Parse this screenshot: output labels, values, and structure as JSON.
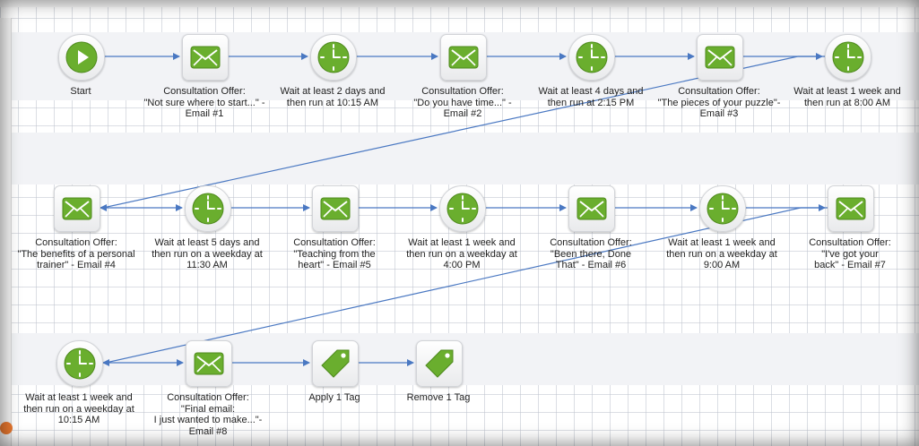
{
  "colors": {
    "edge": "#4a78c2",
    "icon_green": "#6aae2e",
    "band": "#f2f3f6",
    "accent_dot": "#e8772e"
  },
  "nodes": [
    {
      "icon": "play-icon",
      "label": "Start"
    },
    {
      "icon": "email-icon",
      "label": "Consultation Offer:\n\"Not sure where to start...\" -\nEmail #1"
    },
    {
      "icon": "clock-icon",
      "label": "Wait at least 2 days and\nthen run at 10:15 AM"
    },
    {
      "icon": "email-icon",
      "label": "Consultation Offer:\n\"Do you have time...\" -\nEmail #2"
    },
    {
      "icon": "clock-icon",
      "label": "Wait at least 4 days and\nthen run at 2:15 PM"
    },
    {
      "icon": "email-icon",
      "label": "Consultation Offer:\n\"The pieces of your puzzle\"-\nEmail #3"
    },
    {
      "icon": "clock-icon",
      "label": "Wait at least 1 week and\nthen run at 8:00 AM"
    },
    {
      "icon": "email-icon",
      "label": "Consultation Offer:\n\"The benefits of a personal\ntrainer\" - Email #4"
    },
    {
      "icon": "clock-icon",
      "label": "Wait at least 5 days and\nthen run on a weekday at\n11:30 AM"
    },
    {
      "icon": "email-icon",
      "label": "Consultation Offer:\n\"Teaching from the\nheart\" - Email #5"
    },
    {
      "icon": "clock-icon",
      "label": "Wait at least 1 week and\nthen run on a weekday at\n4:00 PM"
    },
    {
      "icon": "email-icon",
      "label": "Consultation Offer:\n\"Been there, Done\nThat\" - Email #6"
    },
    {
      "icon": "clock-icon",
      "label": "Wait at least 1 week and\nthen run on a weekday at\n9:00 AM"
    },
    {
      "icon": "email-icon",
      "label": "Consultation Offer:\n\"I've got your\nback\" - Email #7"
    },
    {
      "icon": "clock-icon",
      "label": "Wait at least 1 week and\nthen run on a weekday at\n10:15 AM"
    },
    {
      "icon": "email-icon",
      "label": "Consultation Offer:\n\"Final email:\nI just wanted to make...\"-\nEmail #8"
    },
    {
      "icon": "tag-icon",
      "label": "Apply 1 Tag"
    },
    {
      "icon": "tag-icon",
      "label": "Remove 1 Tag"
    }
  ],
  "edges": [
    [
      0,
      1
    ],
    [
      1,
      2
    ],
    [
      2,
      3
    ],
    [
      3,
      4
    ],
    [
      4,
      5
    ],
    [
      5,
      6
    ],
    [
      6,
      7
    ],
    [
      7,
      8
    ],
    [
      8,
      9
    ],
    [
      9,
      10
    ],
    [
      10,
      11
    ],
    [
      11,
      12
    ],
    [
      12,
      13
    ],
    [
      13,
      14
    ],
    [
      14,
      15
    ],
    [
      15,
      16
    ],
    [
      16,
      17
    ]
  ]
}
